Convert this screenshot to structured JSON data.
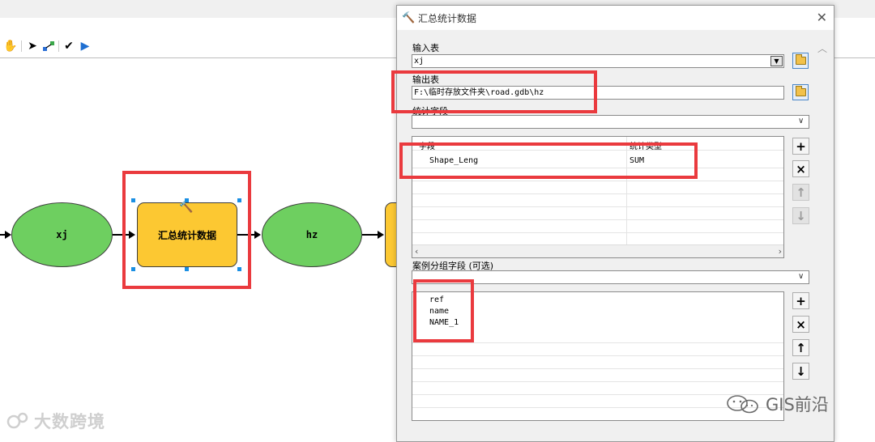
{
  "canvas": {
    "nodes": {
      "input_node": "xj",
      "tool_node": "汇总统计数据",
      "output_node": "hz"
    }
  },
  "toolbar": {
    "icons": [
      "pan-hand-icon",
      "select-arrow-icon",
      "connect-icon",
      "validate-check-icon",
      "run-icon"
    ]
  },
  "dialog": {
    "title": "汇总统计数据",
    "input_table": {
      "label": "输入表",
      "value": "xj"
    },
    "output_table": {
      "label": "输出表",
      "value": "F:\\临时存放文件夹\\road.gdb\\hz"
    },
    "stat_fields": {
      "label": "统计字段",
      "combo_value": "",
      "columns": [
        "字段",
        "统计类型"
      ],
      "rows": [
        {
          "field": "Shape_Leng",
          "type": "SUM"
        }
      ]
    },
    "case_fields": {
      "label": "案例分组字段 (可选)",
      "combo_value": "",
      "items": [
        "ref",
        "name",
        "NAME_1"
      ]
    },
    "buttons": {
      "add": "+",
      "remove": "×",
      "up": "↑",
      "down": "↓"
    }
  },
  "watermarks": {
    "left": "大数跨境",
    "right": "GIS前沿"
  },
  "colors": {
    "highlight": "#ea3a3e",
    "ellipse_fill": "#6ecf60",
    "tool_fill": "#fcc832",
    "selection_handle": "#1a8fe3"
  }
}
